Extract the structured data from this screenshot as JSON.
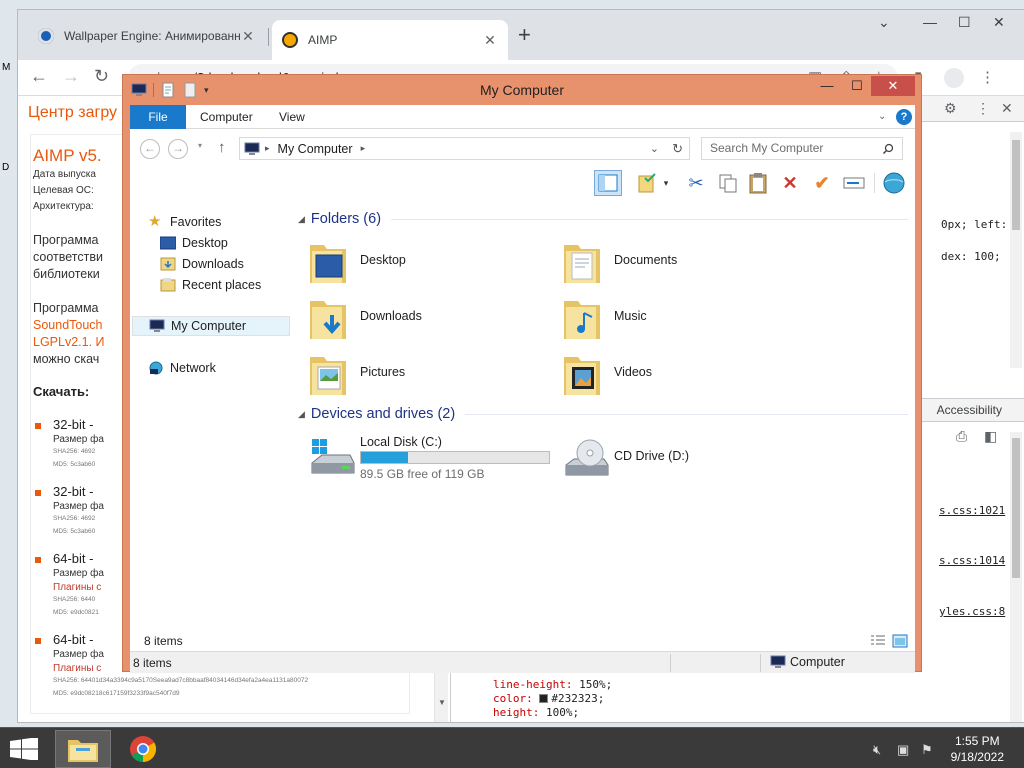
{
  "browser": {
    "tabs": [
      {
        "title": "Wallpaper Engine: Анимированн",
        "close": "✕"
      },
      {
        "title": "AIMP",
        "close": "✕"
      }
    ],
    "url": "aimp.ru/?do=download&os=windows",
    "page_header": "Центр загру",
    "aimp_title": "AIMP v5.",
    "meta": [
      "Дата выпуска",
      "Целевая ОС:",
      "Архитектура:"
    ],
    "para1": [
      "Программа",
      "соответстви",
      "библиотеки"
    ],
    "para2": [
      "Программа",
      "SoundTouch",
      "LGPLv2.1. И",
      "можно скач"
    ],
    "download_heading": "Скачать:",
    "downloads": [
      {
        "name": "32-bit -",
        "size": "Размер фа",
        "red": "",
        "sha": "SHA256: 4692",
        "md5": "MD5: 5c3ab60"
      },
      {
        "name": "32-bit -",
        "size": "Размер фа",
        "red": "",
        "sha": "SHA256: 4692",
        "md5": "MD5: 5c3ab60"
      },
      {
        "name": "64-bit -",
        "size": "Размер фа",
        "red": "Плагины с",
        "sha": "SHA256: 6440",
        "md5": "MD5: e9dc0821"
      },
      {
        "name": "64-bit -",
        "size": "Размер фа",
        "red": "Плагины с",
        "sha": "SHA256: 64401d34a3394c9a5170Seea9ad7c8bbaaf84034146d34efa2a4ea1131a80072",
        "md5": "MD5: e9dc08218c617159f3233f9ac540f7d9"
      }
    ],
    "devtools": {
      "code_lines": [
        {
          "text": "0px; left:"
        },
        {
          "text": "dex: 100;"
        }
      ],
      "accessibility_tab": "Accessibility",
      "links": [
        "s.css:1021",
        "s.css:1014",
        "yles.css:8"
      ],
      "bottom_code": [
        {
          "prop": "line-height:",
          "value": " 150%;"
        },
        {
          "prop": "color:",
          "value": "#232323;"
        },
        {
          "prop": "height:",
          "value": " 100%;"
        }
      ]
    }
  },
  "explorer": {
    "title": "My Computer",
    "ribbon_tabs": [
      "File",
      "Computer",
      "View"
    ],
    "address_crumb": "My Computer",
    "search_placeholder": "Search My Computer",
    "nav": {
      "favorites": "Favorites",
      "desktop": "Desktop",
      "downloads": "Downloads",
      "recent": "Recent places",
      "my_computer": "My Computer",
      "network": "Network"
    },
    "folders_heading": "Folders (6)",
    "folders": [
      "Desktop",
      "Documents",
      "Downloads",
      "Music",
      "Pictures",
      "Videos"
    ],
    "devices_heading": "Devices and drives (2)",
    "drives": [
      {
        "name": "Local Disk (C:)",
        "free": "89.5 GB free of 119 GB",
        "used_fraction": 0.248
      },
      {
        "name": "CD Drive (D:)"
      }
    ],
    "footer_count": "8 items",
    "status_left": "8 items",
    "status_right": "Computer"
  },
  "taskbar": {
    "time": "1:55 PM",
    "date": "9/18/2022"
  },
  "colors": {
    "window_frame": "#e8926d",
    "accent_blue": "#1979ca",
    "link_orange": "#e8590c",
    "drive_bar": "#26a0da"
  }
}
